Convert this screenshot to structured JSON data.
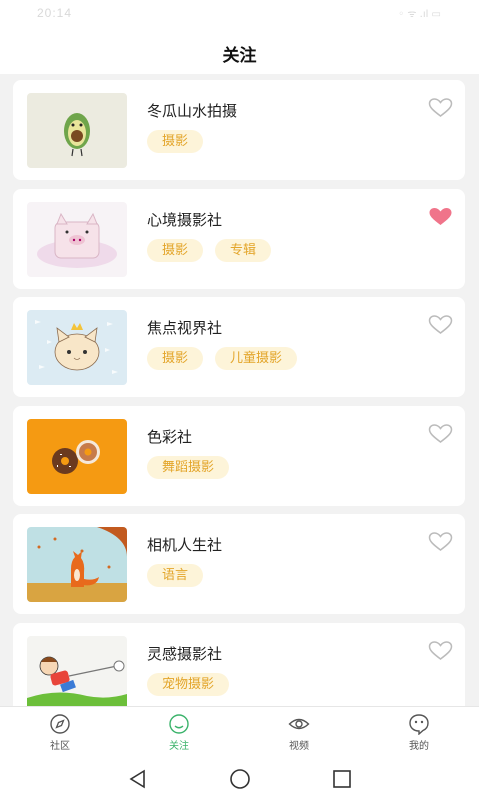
{
  "status": {
    "time": "20:14",
    "icons": "◦ ᯤ .ıl ▭"
  },
  "header": {
    "title": "关注"
  },
  "cards": [
    {
      "name": "冬瓜山水拍摄",
      "tags": [
        "摄影"
      ],
      "favorited": false,
      "thumb": "avocado-thumbnail"
    },
    {
      "name": "心境摄影社",
      "tags": [
        "摄影",
        "专辑"
      ],
      "favorited": true,
      "thumb": "pig-thumbnail"
    },
    {
      "name": "焦点视界社",
      "tags": [
        "摄影",
        "儿童摄影"
      ],
      "favorited": false,
      "thumb": "cat-thumbnail"
    },
    {
      "name": "色彩社",
      "tags": [
        "舞蹈摄影"
      ],
      "favorited": false,
      "thumb": "donut-thumbnail"
    },
    {
      "name": "相机人生社",
      "tags": [
        "语言"
      ],
      "favorited": false,
      "thumb": "fox-thumbnail"
    },
    {
      "name": "灵感摄影社",
      "tags": [
        "宠物摄影"
      ],
      "favorited": false,
      "thumb": "kid-thumbnail"
    }
  ],
  "tabs": [
    {
      "label": "社区",
      "icon": "compass-icon",
      "active": false
    },
    {
      "label": "关注",
      "icon": "smile-icon",
      "active": true
    },
    {
      "label": "视频",
      "icon": "eye-icon",
      "active": false
    },
    {
      "label": "我的",
      "icon": "chat-icon",
      "active": false
    }
  ],
  "colors": {
    "accent": "#3bb36b",
    "tag_bg": "#fdf4d9",
    "tag_text": "#e3a52a",
    "heart_on": "#f0748a",
    "heart_off": "#bbbbbb"
  }
}
